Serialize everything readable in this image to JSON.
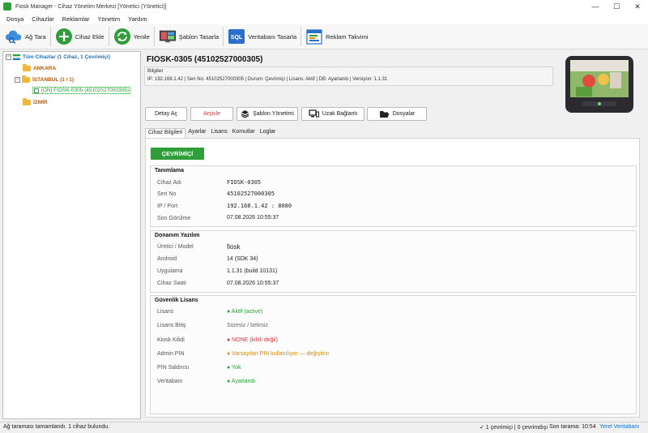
{
  "window": {
    "title": "Fiosk Manager - Cihaz Yönetim Merkezi  [Yönetici (Yönetici)]"
  },
  "menu": [
    "Dosya",
    "Cihazlar",
    "Reklamlar",
    "Yönetim",
    "Yardım"
  ],
  "toolbar": {
    "scan": "Ağ Tara",
    "add_device": "Cihaz Ekle",
    "refresh": "Yenile",
    "template_design": "Şablon Tasarla",
    "db_design": "Veritabanı Tasarla",
    "ad_calendar": "Reklam Takvimi"
  },
  "tree": {
    "root": "Tüm Cihazlar (1 Cihaz, 1 Çevrimiçi)",
    "groups": [
      "ANKARA",
      "İSTANBUL (1 / 1)",
      "İZMİR"
    ],
    "device": "[ON] FIOSK-0305 (45102527000305)"
  },
  "device": {
    "title": "FIOSK-0305 (45102527000305)",
    "info_label": "Bilgiler",
    "info_line": "IP: 192.168.1.42  |  Seri No: 45102527000305  |  Durum: Çevrimiçi  |  Lisans: Aktif  |  DB: Ayarlandı  |  Versiyon: 1.1.31"
  },
  "actions": {
    "detail": "Detay Aç",
    "archive": "Arşivle",
    "templates": "Şablon Yönetimi",
    "remote": "Uzak Bağlantı",
    "files": "Dosyalar"
  },
  "tabs": [
    "Cihaz Bilgileri",
    "Ayarlar",
    "Lisans",
    "Komutlar",
    "Loglar"
  ],
  "status_badge": "ÇEVRİMİÇİ",
  "identity": {
    "title": "Tanımlama",
    "rows": [
      {
        "label": "Cihaz Adı",
        "value": "FIOSK-0305"
      },
      {
        "label": "Seri No",
        "value": "45102527000305"
      },
      {
        "label": "IP / Port",
        "value": "192.168.1.42 : 8080"
      },
      {
        "label": "Son Görülme",
        "value": "07.08.2026 10:55:37"
      }
    ]
  },
  "hardware": {
    "title": "Donanım  Yazılım",
    "rows": [
      {
        "label": "Üretici / Model",
        "value": "fiosk"
      },
      {
        "label": "Android",
        "value": "14 (SDK 34)"
      },
      {
        "label": "Uygulama",
        "value": "1.1.31 (build 10131)"
      },
      {
        "label": "Cihaz Saati",
        "value": "07.08.2026 10:55:37"
      }
    ]
  },
  "security": {
    "title": "Güvenlik  Lisans",
    "rows": [
      {
        "label": "Lisans",
        "value": "● Aktif (active)",
        "color": "#2e9d3a"
      },
      {
        "label": "Lisans Bitiş",
        "value": "Süresiz / belirsiz",
        "color": "#666666"
      },
      {
        "label": "Kiosk Kilidi",
        "value": "● NONE (kilitli değil)",
        "color": "#d9363e"
      },
      {
        "label": "Admin PIN",
        "value": "● Varsayılan PIN kullanılıyor — değiştirin",
        "color": "#e08a00"
      },
      {
        "label": "PIN Saldırısı",
        "value": "● Yok",
        "color": "#2e9d3a"
      },
      {
        "label": "Veritabanı",
        "value": "● Ayarlandı",
        "color": "#2e9d3a"
      }
    ]
  },
  "statusbar": {
    "left": "Ağ taraması tamamlandı. 1 cihaz bulundu.",
    "counts": "✓ 1 çevrimiçi | 0 çevrimdışı",
    "last_scan": "Son tarama: 10:54",
    "db": "Yerel Veritabanı"
  },
  "colors": {
    "accent_green": "#2e9d3a",
    "link_blue": "#1a6fc9"
  }
}
